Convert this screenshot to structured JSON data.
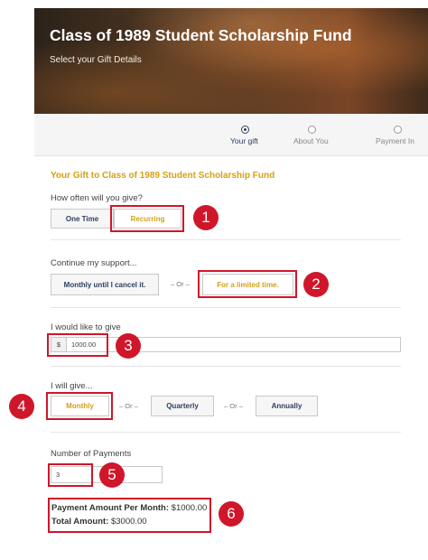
{
  "header": {
    "title": "Class of 1989 Student Scholarship Fund",
    "subtitle": "Select your Gift Details"
  },
  "steps": [
    {
      "label": "Your gift",
      "active": true
    },
    {
      "label": "About You",
      "active": false
    },
    {
      "label": "Payment In",
      "active": false
    }
  ],
  "form": {
    "section_title": "Your Gift to Class of 1989 Student Scholarship Fund",
    "frequency": {
      "question": "How often will you give?",
      "options": [
        "One Time",
        "Recurring"
      ],
      "selected": "Recurring"
    },
    "support": {
      "question": "Continue my support...",
      "options": [
        "Monthly until I cancel it.",
        "For a limited time."
      ],
      "or_label": "– Or –",
      "selected": "For a limited time."
    },
    "amount": {
      "question": "I would like to give",
      "currency": "$",
      "value": "1000.00"
    },
    "schedule": {
      "question": "I will give...",
      "options": [
        "Monthly",
        "Quarterly",
        "Annually"
      ],
      "or_label": "– Or –",
      "selected": "Monthly"
    },
    "payments": {
      "question": "Number of Payments",
      "value": "3"
    },
    "summary": {
      "per_month_label": "Payment Amount Per Month:",
      "per_month_value": "$1000.00",
      "total_label": "Total Amount:",
      "total_value": "$3000.00"
    }
  },
  "annotations": [
    "1",
    "2",
    "3",
    "4",
    "5",
    "6"
  ],
  "colors": {
    "accent_gold": "#d4a017",
    "navy": "#2b3f5e",
    "annotation_red": "#d0162a"
  }
}
